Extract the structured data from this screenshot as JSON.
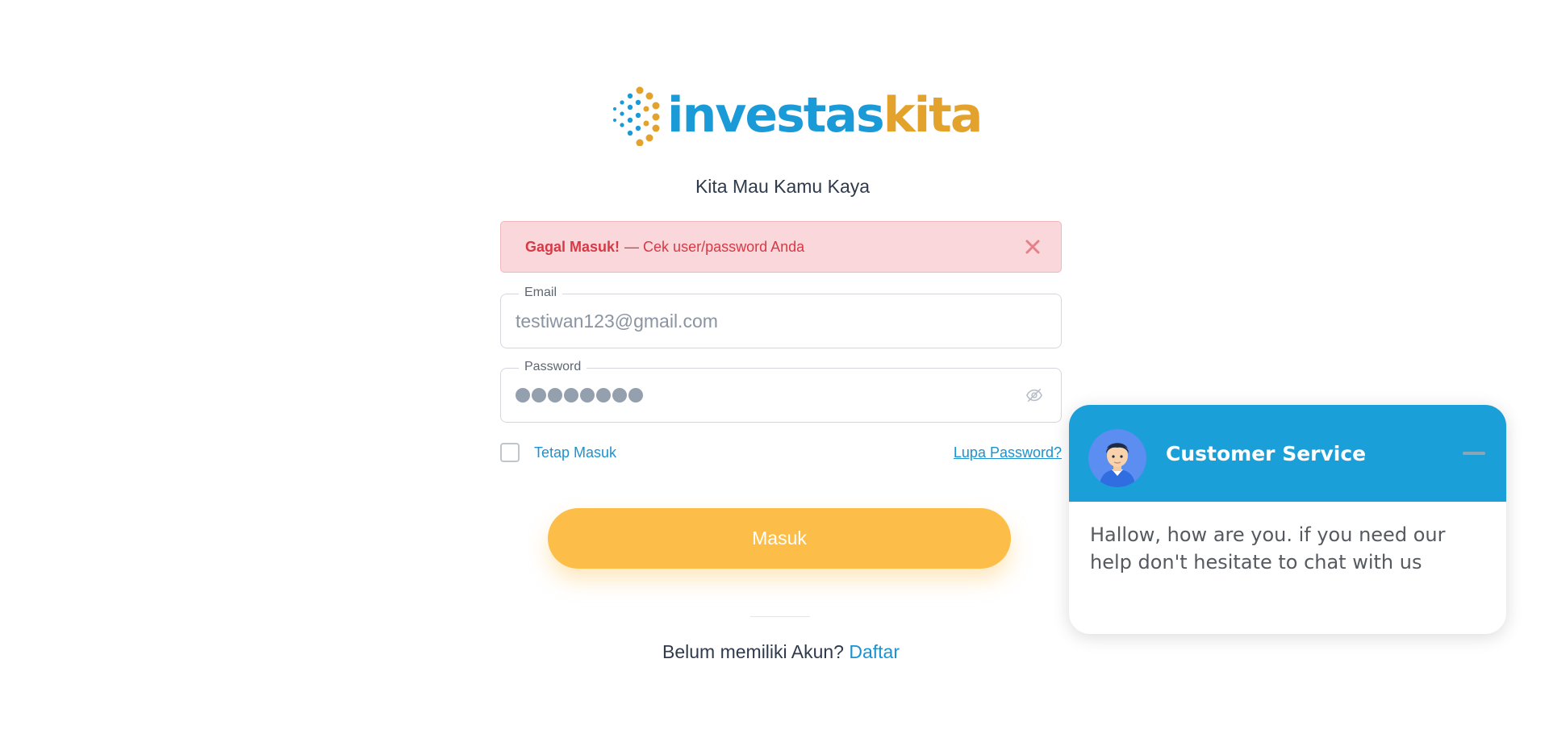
{
  "logo": {
    "part1": "investas",
    "part2": "kita",
    "colors": {
      "blue": "#1a9ad6",
      "gold": "#e3a22b"
    }
  },
  "tagline": "Kita Mau Kamu Kaya",
  "alert": {
    "title": "Gagal Masuk!",
    "message": "— Cek user/password Anda",
    "close_icon": "close-icon",
    "color": "#d63a46",
    "background": "#f9d7da"
  },
  "form": {
    "email_label": "Email",
    "email_value": "testiwan123@gmail.com",
    "password_label": "Password",
    "password_masked_length": 8,
    "password_toggle_icon": "eye-slash-icon",
    "remember_label": "Tetap Masuk",
    "remember_checked": false,
    "forgot_label": "Lupa Password?",
    "submit_label": "Masuk",
    "submit_color": "#fdbe49"
  },
  "signup": {
    "prompt": "Belum memiliki Akun?",
    "link": "Daftar"
  },
  "chat": {
    "title": "Customer Service",
    "message": "Hallow, how are you. if you need our help don't hesitate to chat with us",
    "header_color": "#1a9fd8",
    "avatar_icon": "agent-avatar-icon",
    "minimize_icon": "minimize-icon"
  }
}
